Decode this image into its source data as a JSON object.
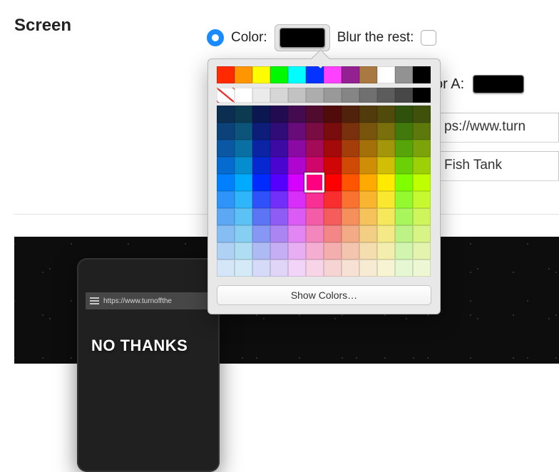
{
  "heading": "Screen",
  "row1": {
    "colorLabel": "Color:",
    "blurLabel": "Blur the rest:"
  },
  "row2": {
    "orLabel": "or A:"
  },
  "urlField": "ps://www.turn",
  "titleField": "Fish Tank",
  "overlayText": "NO THANKS",
  "phoneUrl": "https://www.turnoffthe",
  "popover": {
    "showColors": "Show Colors…",
    "presets": [
      "#ff2a00",
      "#ff9500",
      "#fffb00",
      "#00f900",
      "#00fdff",
      "#0433ff",
      "#ff40ff",
      "#942192",
      "#aa7942",
      "#ffffff",
      "#929292",
      "#000000"
    ],
    "grays": [
      "none",
      "#ffffff",
      "#ebebeb",
      "#d6d6d6",
      "#c2c2c2",
      "#adadad",
      "#999999",
      "#858585",
      "#707070",
      "#5c5c5c",
      "#474747",
      "#000000"
    ],
    "gridHues": [
      210,
      200,
      230,
      260,
      290,
      330,
      0,
      20,
      40,
      55,
      90,
      75
    ],
    "selected": {
      "row": 4,
      "col": 5
    }
  }
}
